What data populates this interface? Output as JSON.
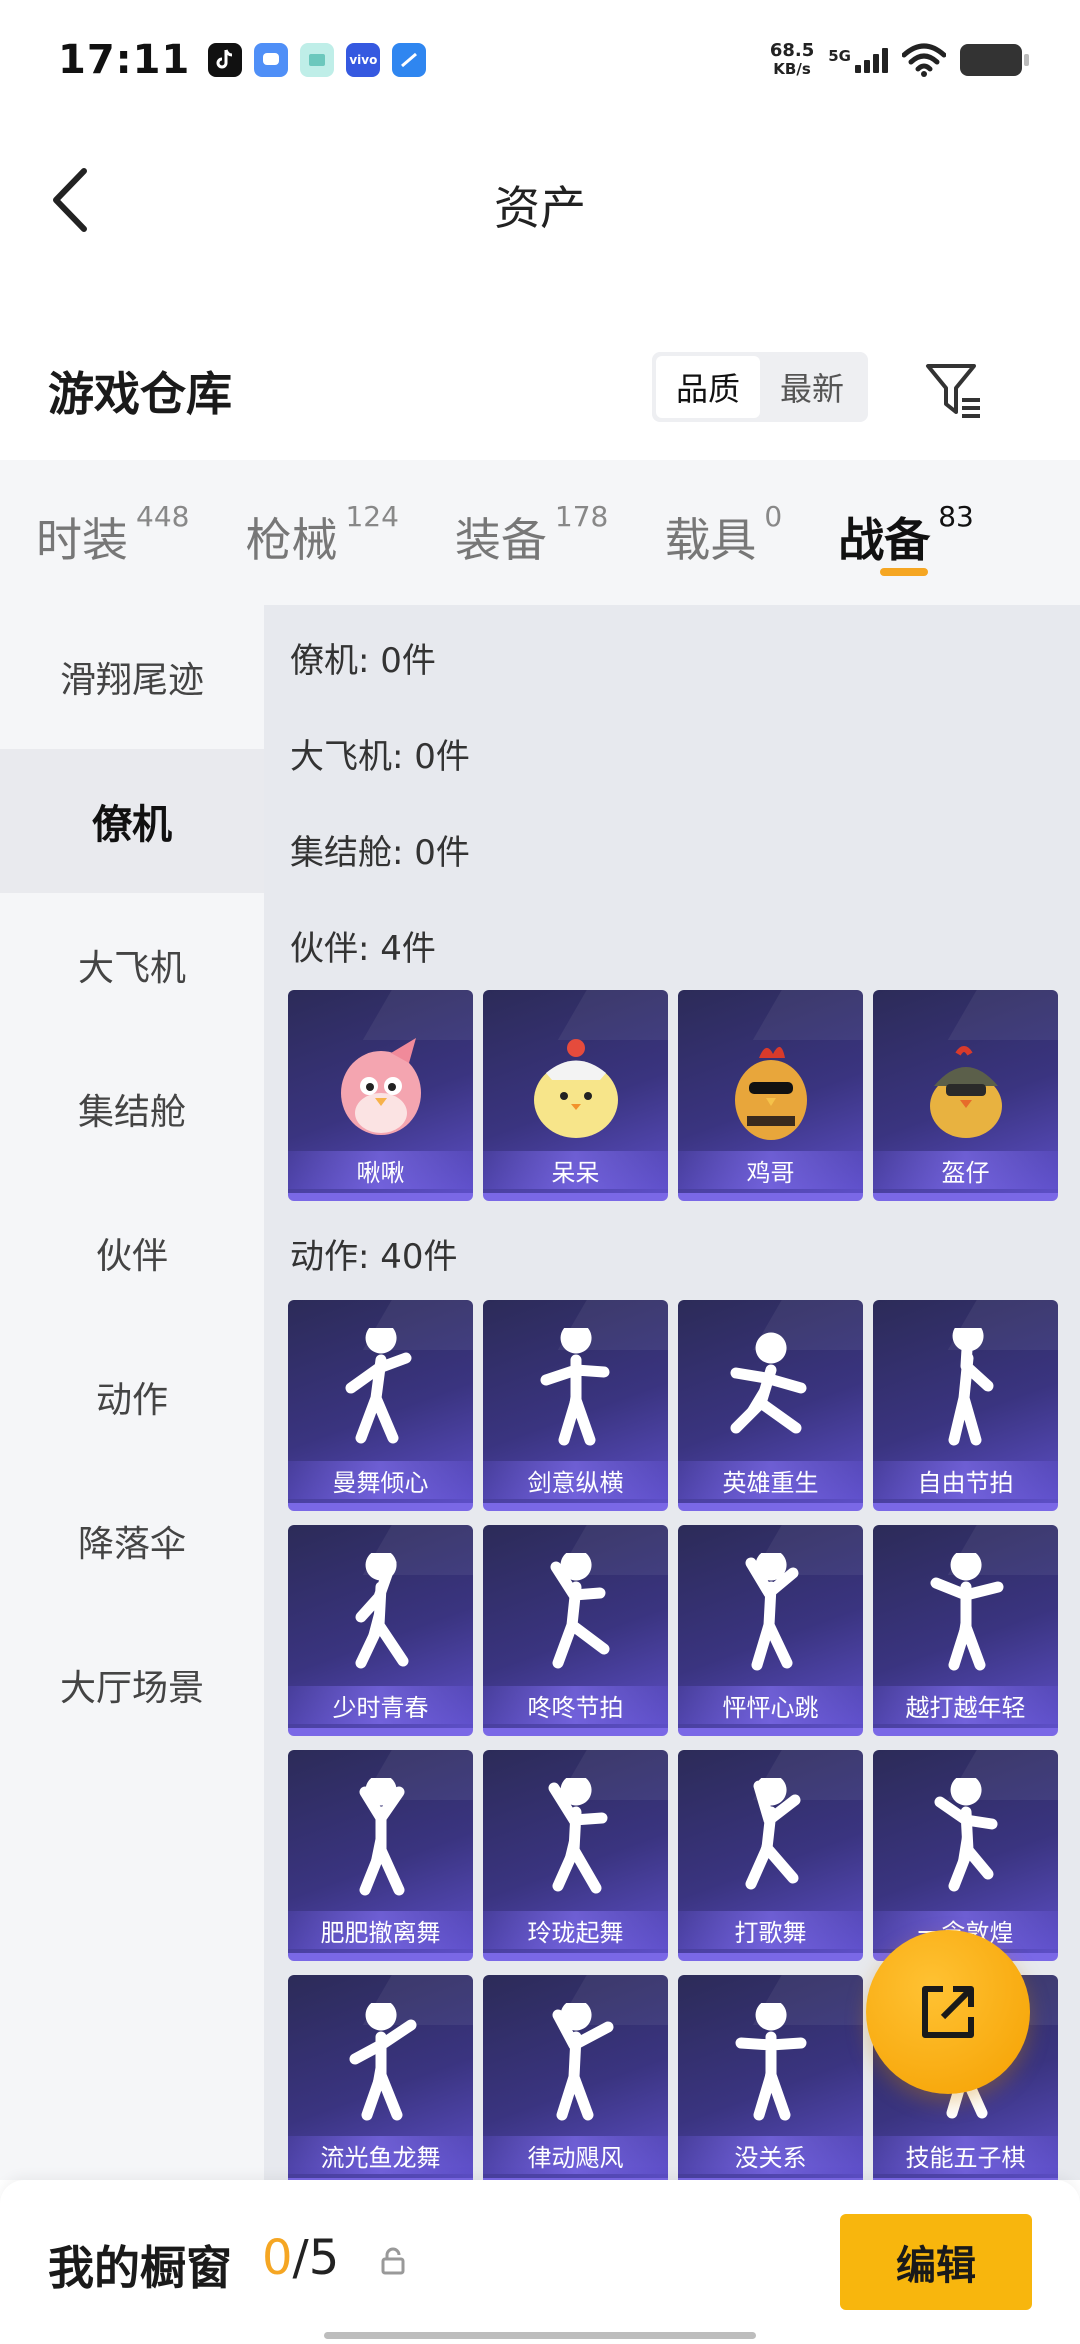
{
  "status_bar": {
    "time": "17:11",
    "net_speed": "68.5",
    "net_unit": "KB/s",
    "signal": "5G",
    "apps": [
      {
        "icon": "tiktok-icon",
        "color": "#111111"
      },
      {
        "icon": "chat-app-icon",
        "color": "#4f8ff7"
      },
      {
        "icon": "message-app-icon",
        "color": "#9fe0d9"
      },
      {
        "icon": "vivo-app-icon",
        "color": "#3559e0"
      },
      {
        "icon": "browser-app-icon",
        "color": "#2f86f0"
      }
    ]
  },
  "header": {
    "title": "资产",
    "back_icon": "back-arrow-icon"
  },
  "warehouse": {
    "title": "游戏仓库",
    "sort_options": [
      "品质",
      "最新"
    ],
    "sort_selected": "品质",
    "filter_icon": "filter-icon"
  },
  "tabs": [
    {
      "label": "时装",
      "count": "448"
    },
    {
      "label": "枪械",
      "count": "124"
    },
    {
      "label": "装备",
      "count": "178"
    },
    {
      "label": "载具",
      "count": "0"
    },
    {
      "label": "战备",
      "count": "83",
      "active": true
    }
  ],
  "sidebar": [
    {
      "label": "滑翔尾迹"
    },
    {
      "label": "僚机",
      "active": true
    },
    {
      "label": "大飞机"
    },
    {
      "label": "集结舱"
    },
    {
      "label": "伙伴"
    },
    {
      "label": "动作"
    },
    {
      "label": "降落伞"
    },
    {
      "label": "大厅场景"
    }
  ],
  "sections": {
    "wingman": "僚机: 0件",
    "airplane": "大飞机: 0件",
    "pod": "集结舱: 0件",
    "partner": "伙伴: 4件",
    "emote": "动作: 40件"
  },
  "partners": [
    "啾啾",
    "呆呆",
    "鸡哥",
    "盔仔"
  ],
  "emotes": [
    "曼舞倾心",
    "剑意纵横",
    "英雄重生",
    "自由节拍",
    "少时青春",
    "咚咚节拍",
    "怦怦心跳",
    "越打越年轻",
    "肥肥撤离舞",
    "玲珑起舞",
    "打歌舞",
    "一念敦煌",
    "流光鱼龙舞",
    "律动飓风",
    "没关系",
    "技能五子棋"
  ],
  "emote_art_text": {
    "3": "英雄重生"
  },
  "fab": {
    "icon": "share-external-icon"
  },
  "bottom_bar": {
    "label": "我的橱窗",
    "current": "0",
    "total": "/5",
    "lock_icon": "lock-icon",
    "edit_label": "编辑"
  },
  "colors": {
    "accent": "#f5a623",
    "edit_button": "#f8b60d",
    "card_bottom": "#7a68e6"
  }
}
